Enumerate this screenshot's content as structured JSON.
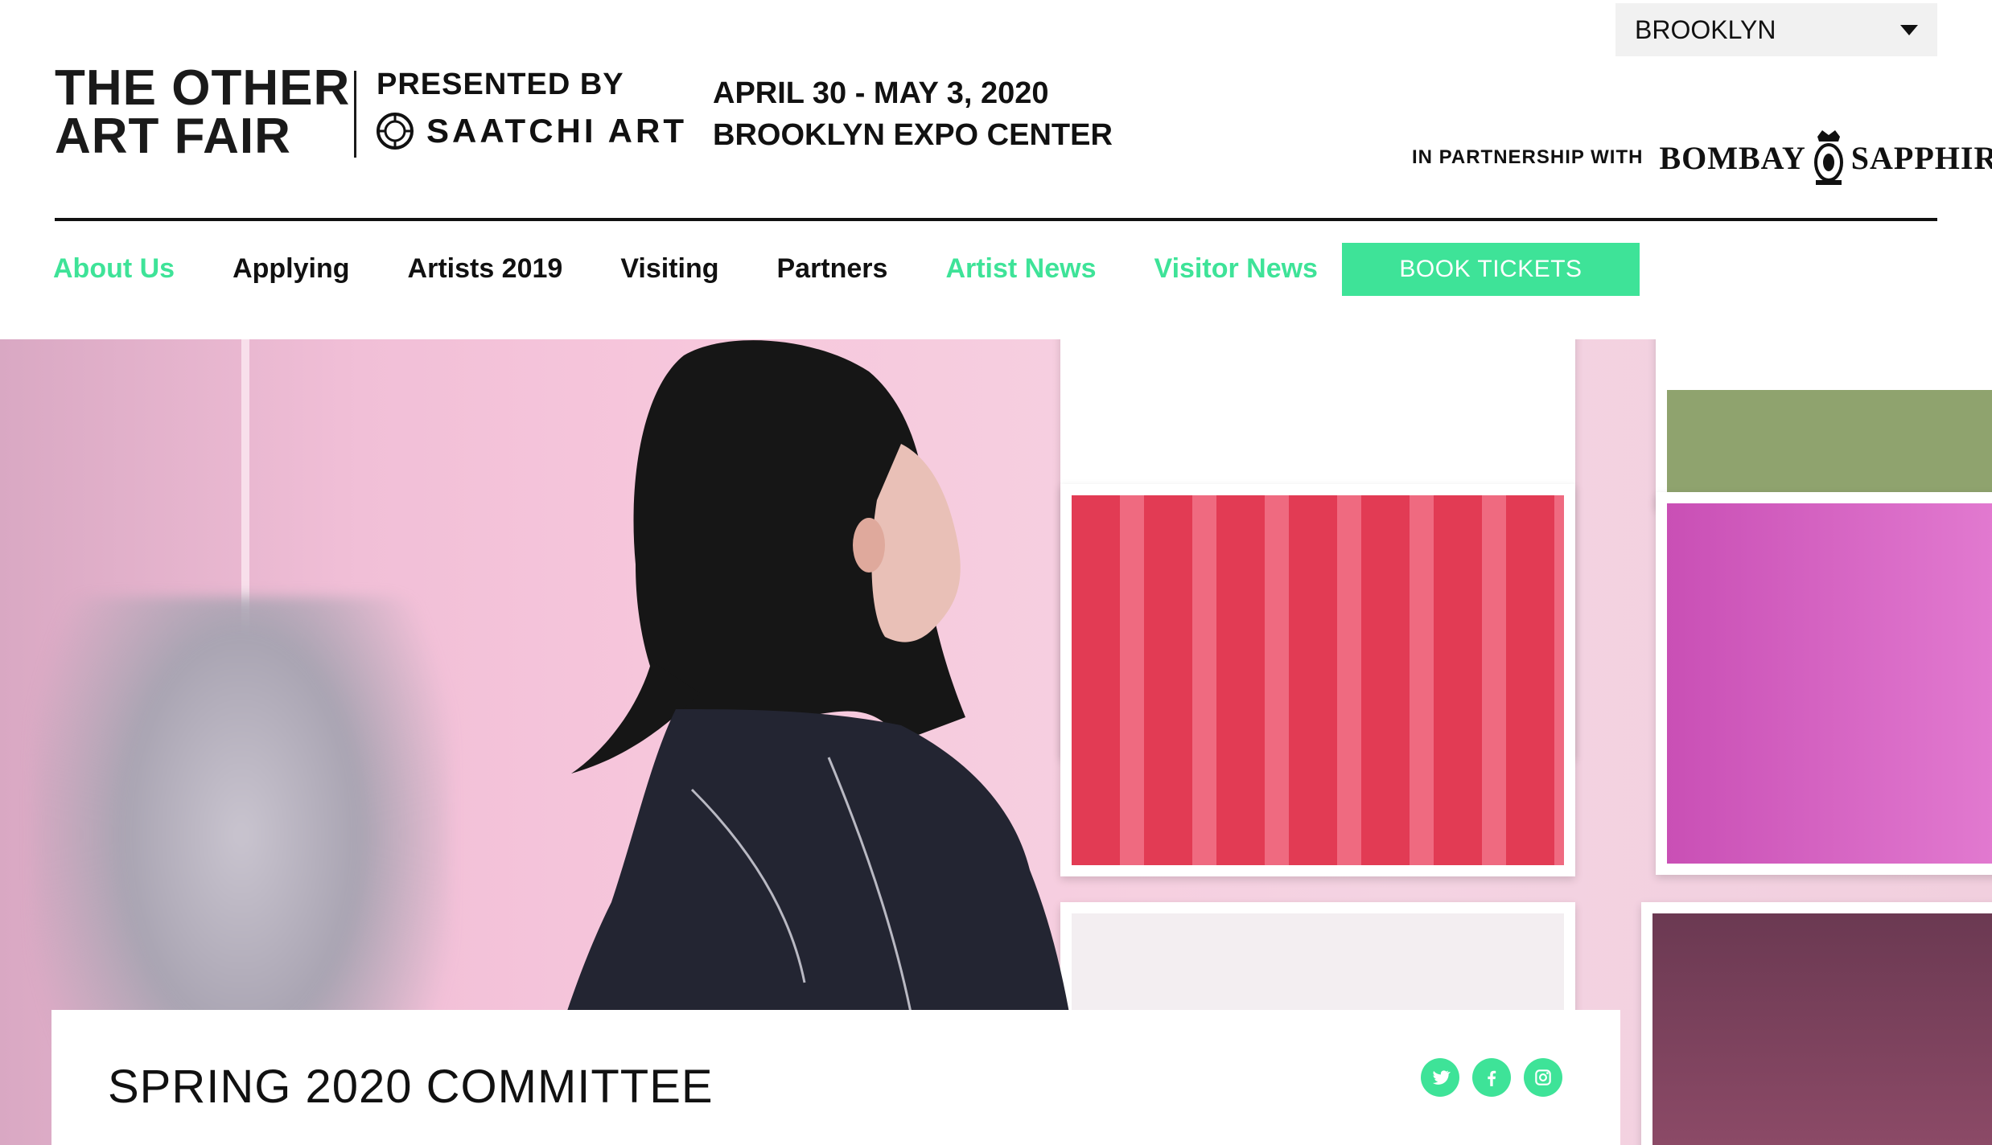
{
  "header": {
    "logo_line1": "THE OTHER",
    "logo_line2": "ART FAIR",
    "presented_by": "PRESENTED BY",
    "presenter": "SAATCHI ART",
    "date_line": "APRIL 30 - MAY 3, 2020",
    "venue_line": "BROOKLYN EXPO CENTER",
    "region_selector": "BROOKLYN",
    "partnership_label": "IN PARTNERSHIP WITH",
    "partner_word1": "BOMBAY",
    "partner_word2": "SAPPHIRE"
  },
  "nav": {
    "items": [
      {
        "label": "About Us",
        "accent": true
      },
      {
        "label": "Applying",
        "accent": false
      },
      {
        "label": "Artists 2019",
        "accent": false
      },
      {
        "label": "Visiting",
        "accent": false
      },
      {
        "label": "Partners",
        "accent": false
      },
      {
        "label": "Artist News",
        "accent": true
      },
      {
        "label": "Visitor News",
        "accent": true
      }
    ],
    "cta": "BOOK TICKETS"
  },
  "hero": {
    "title": "SPRING 2020 COMMITTEE"
  },
  "social": {
    "icons": [
      "twitter-icon",
      "facebook-icon",
      "instagram-icon"
    ]
  },
  "colors": {
    "accent": "#3ee398",
    "text": "#111111",
    "region_bg": "#f1f1f1"
  }
}
